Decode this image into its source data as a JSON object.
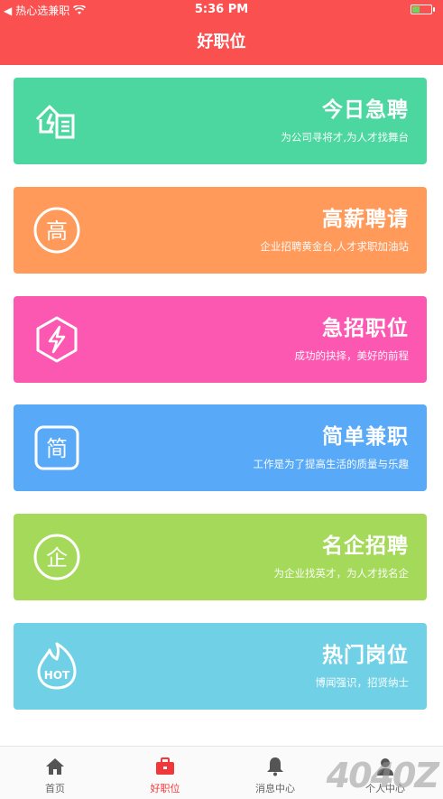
{
  "status": {
    "carrier": "热心选兼职",
    "time": "5:36 PM"
  },
  "header": {
    "title": "好职位"
  },
  "cards": [
    {
      "title": "今日急聘",
      "subtitle": "为公司寻将才,为人才找舞台",
      "color": "#4cd7a0",
      "icon": "building-list-icon"
    },
    {
      "title": "高薪聘请",
      "subtitle": "企业招聘黄金台,人才求职加油站",
      "color": "#ff9a5b",
      "icon": "gao-circle-icon",
      "icon_char": "高"
    },
    {
      "title": "急招职位",
      "subtitle": "成功的抉择，美好的前程",
      "color": "#fc58b2",
      "icon": "lightning-hexagon-icon"
    },
    {
      "title": "简单兼职",
      "subtitle": "工作是为了提高生活的质量与乐趣",
      "color": "#58a9f8",
      "icon": "jian-square-icon",
      "icon_char": "简"
    },
    {
      "title": "名企招聘",
      "subtitle": "为企业找英才，为人才找名企",
      "color": "#a4d95a",
      "icon": "qi-circle-icon",
      "icon_char": "企"
    },
    {
      "title": "热门岗位",
      "subtitle": "博闻强识，招贤纳士",
      "color": "#6fd0e6",
      "icon": "hot-flame-icon",
      "icon_char": "HOT"
    }
  ],
  "tabs": [
    {
      "label": "首页",
      "icon": "home-icon"
    },
    {
      "label": "好职位",
      "icon": "briefcase-icon",
      "active": true
    },
    {
      "label": "消息中心",
      "icon": "bell-icon"
    },
    {
      "label": "个人中心",
      "icon": "person-icon"
    }
  ],
  "watermark": "4040Z"
}
